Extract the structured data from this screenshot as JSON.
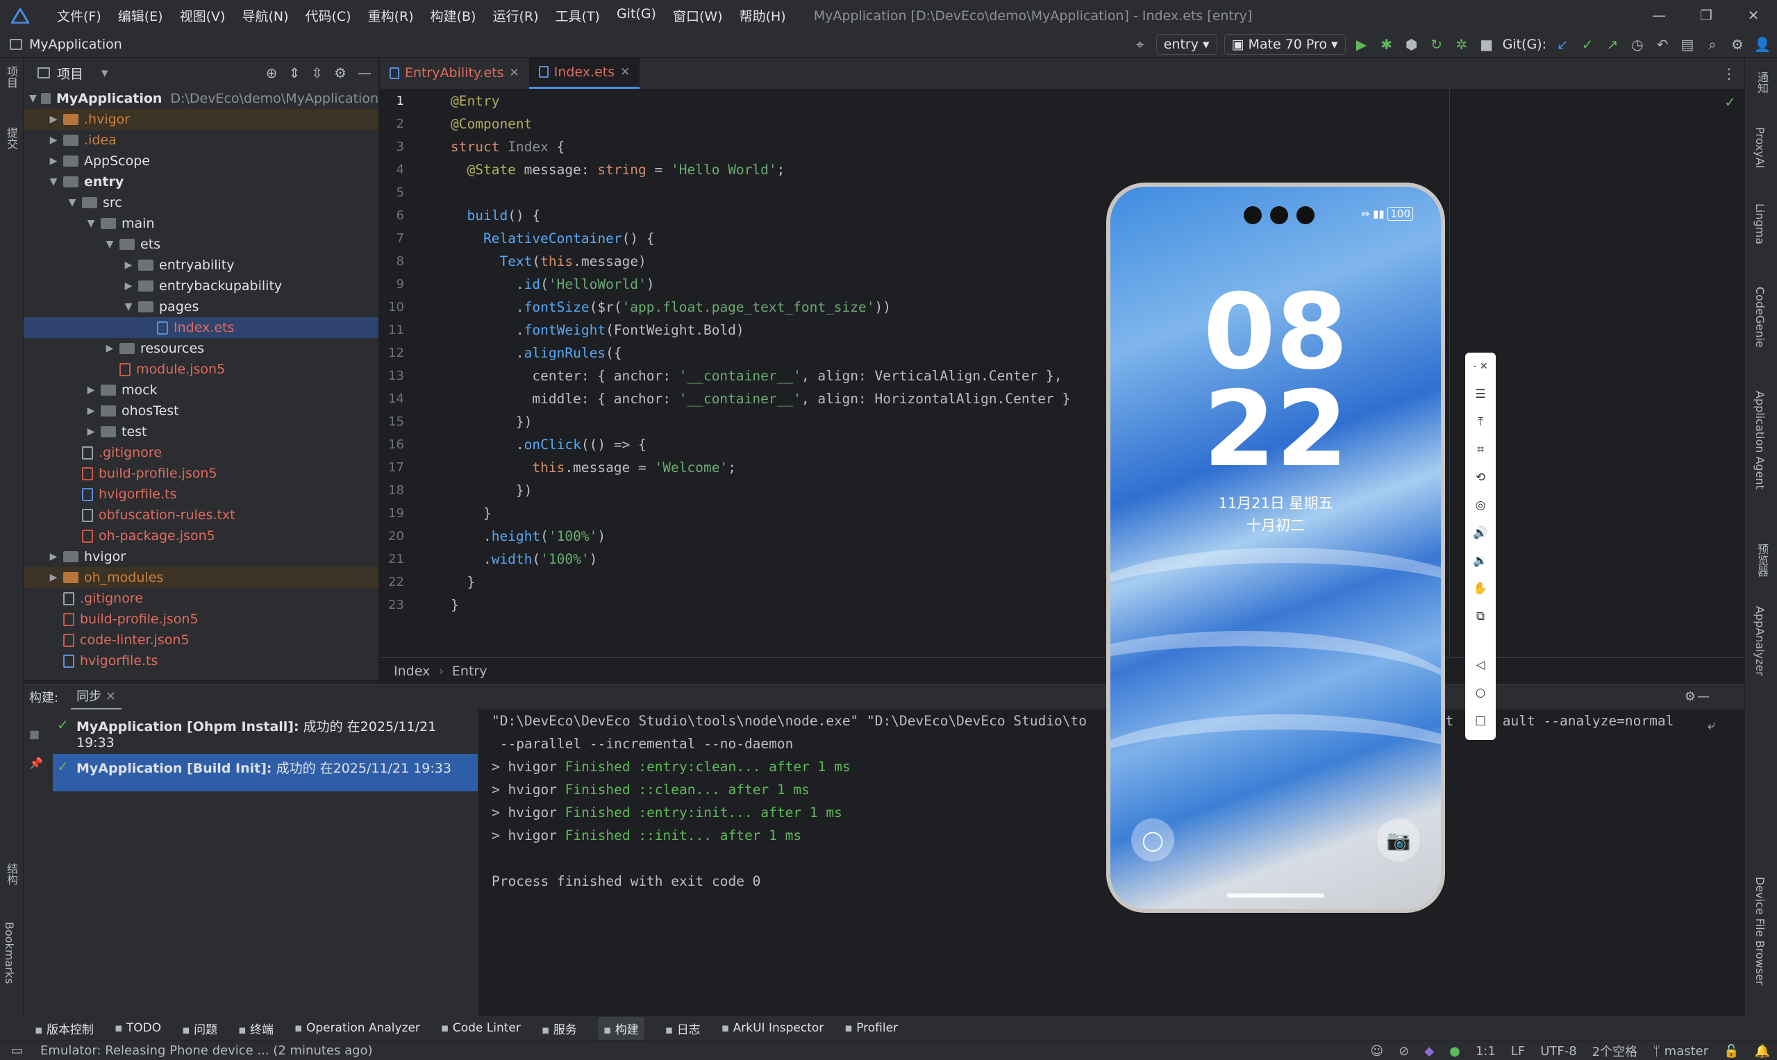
{
  "titlebar": {
    "menus": [
      "文件(F)",
      "编辑(E)",
      "视图(V)",
      "导航(N)",
      "代码(C)",
      "重构(R)",
      "构建(B)",
      "运行(R)",
      "工具(T)",
      "Git(G)",
      "窗口(W)",
      "帮助(H)"
    ],
    "window_title": "MyApplication [D:\\DevEco\\demo\\MyApplication] - Index.ets [entry]"
  },
  "toolbar": {
    "project_name": "MyApplication",
    "run_config": "entry",
    "device": "Mate 70 Pro",
    "git_label": "Git(G):"
  },
  "project_panel": {
    "title": "项目",
    "root": {
      "name": "MyApplication",
      "path": "D:\\DevEco\\demo\\MyApplication"
    },
    "rows": [
      {
        "label": ".hvigor",
        "depth": 1,
        "arrow": "▶",
        "kind": "folder-orange",
        "color": "or",
        "state": "exc"
      },
      {
        "label": ".idea",
        "depth": 1,
        "arrow": "▶",
        "kind": "folder",
        "color": "or",
        "state": ""
      },
      {
        "label": "AppScope",
        "depth": 1,
        "arrow": "▶",
        "kind": "folder",
        "color": "def",
        "state": ""
      },
      {
        "label": "entry",
        "depth": 1,
        "arrow": "▼",
        "kind": "folder",
        "color": "def",
        "state": "",
        "bold": true
      },
      {
        "label": "src",
        "depth": 2,
        "arrow": "▼",
        "kind": "folder",
        "color": "def",
        "state": ""
      },
      {
        "label": "main",
        "depth": 3,
        "arrow": "▼",
        "kind": "folder",
        "color": "def",
        "state": ""
      },
      {
        "label": "ets",
        "depth": 4,
        "arrow": "▼",
        "kind": "folder",
        "color": "def",
        "state": ""
      },
      {
        "label": "entryability",
        "depth": 5,
        "arrow": "▶",
        "kind": "folder",
        "color": "def",
        "state": ""
      },
      {
        "label": "entrybackupability",
        "depth": 5,
        "arrow": "▶",
        "kind": "folder",
        "color": "def",
        "state": ""
      },
      {
        "label": "pages",
        "depth": 5,
        "arrow": "▼",
        "kind": "folder",
        "color": "def",
        "state": ""
      },
      {
        "label": "Index.ets",
        "depth": 6,
        "arrow": "",
        "kind": "file-blue",
        "color": "red",
        "state": "sel"
      },
      {
        "label": "resources",
        "depth": 4,
        "arrow": "▶",
        "kind": "folder",
        "color": "def",
        "state": ""
      },
      {
        "label": "module.json5",
        "depth": 4,
        "arrow": "",
        "kind": "file-red",
        "color": "red",
        "state": ""
      },
      {
        "label": "mock",
        "depth": 3,
        "arrow": "▶",
        "kind": "folder",
        "color": "def",
        "state": ""
      },
      {
        "label": "ohosTest",
        "depth": 3,
        "arrow": "▶",
        "kind": "folder",
        "color": "def",
        "state": ""
      },
      {
        "label": "test",
        "depth": 3,
        "arrow": "▶",
        "kind": "folder",
        "color": "def",
        "state": ""
      },
      {
        "label": ".gitignore",
        "depth": 2,
        "arrow": "",
        "kind": "file",
        "color": "red",
        "state": ""
      },
      {
        "label": "build-profile.json5",
        "depth": 2,
        "arrow": "",
        "kind": "file-red",
        "color": "red",
        "state": ""
      },
      {
        "label": "hvigorfile.ts",
        "depth": 2,
        "arrow": "",
        "kind": "file-blue",
        "color": "red",
        "state": ""
      },
      {
        "label": "obfuscation-rules.txt",
        "depth": 2,
        "arrow": "",
        "kind": "file",
        "color": "red",
        "state": ""
      },
      {
        "label": "oh-package.json5",
        "depth": 2,
        "arrow": "",
        "kind": "file-red",
        "color": "red",
        "state": ""
      },
      {
        "label": "hvigor",
        "depth": 1,
        "arrow": "▶",
        "kind": "folder",
        "color": "def",
        "state": ""
      },
      {
        "label": "oh_modules",
        "depth": 1,
        "arrow": "▶",
        "kind": "folder-orange",
        "color": "or",
        "state": "exc"
      },
      {
        "label": ".gitignore",
        "depth": 1,
        "arrow": "",
        "kind": "file",
        "color": "red",
        "state": ""
      },
      {
        "label": "build-profile.json5",
        "depth": 1,
        "arrow": "",
        "kind": "file-red",
        "color": "red",
        "state": ""
      },
      {
        "label": "code-linter.json5",
        "depth": 1,
        "arrow": "",
        "kind": "file-red",
        "color": "red",
        "state": ""
      },
      {
        "label": "hvigorfile.ts",
        "depth": 1,
        "arrow": "",
        "kind": "file-blue",
        "color": "red",
        "state": ""
      }
    ]
  },
  "editor": {
    "tabs": [
      {
        "label": "EntryAbility.ets",
        "active": false
      },
      {
        "label": "Index.ets",
        "active": true
      }
    ],
    "lines": [
      [
        [
          "an",
          "@Entry"
        ]
      ],
      [
        [
          "an",
          "@Component"
        ]
      ],
      [
        [
          "k",
          "struct "
        ],
        [
          "cls",
          "Index "
        ],
        [
          "w",
          "{"
        ]
      ],
      [
        [
          "w",
          "  "
        ],
        [
          "an",
          "@State "
        ],
        [
          "w",
          "message: "
        ],
        [
          "k",
          "string"
        ],
        [
          "w",
          " = "
        ],
        [
          "s",
          "'Hello World'"
        ],
        [
          "w",
          ";"
        ]
      ],
      [
        [
          "w",
          ""
        ]
      ],
      [
        [
          "w",
          "  "
        ],
        [
          "f",
          "build"
        ],
        [
          "w",
          "() {"
        ]
      ],
      [
        [
          "w",
          "    "
        ],
        [
          "f",
          "RelativeContainer"
        ],
        [
          "w",
          "() {"
        ]
      ],
      [
        [
          "w",
          "      "
        ],
        [
          "f",
          "Text"
        ],
        [
          "w",
          "("
        ],
        [
          "k",
          "this"
        ],
        [
          "w",
          ".message)"
        ]
      ],
      [
        [
          "w",
          "        ."
        ],
        [
          "m",
          "id"
        ],
        [
          "w",
          "("
        ],
        [
          "s",
          "'HelloWorld'"
        ],
        [
          "w",
          ")"
        ]
      ],
      [
        [
          "w",
          "        ."
        ],
        [
          "m",
          "fontSize"
        ],
        [
          "w",
          "($r("
        ],
        [
          "s",
          "'app.float.page_text_font_size'"
        ],
        [
          "w",
          "))"
        ]
      ],
      [
        [
          "w",
          "        ."
        ],
        [
          "m",
          "fontWeight"
        ],
        [
          "w",
          "(FontWeight.Bold)"
        ]
      ],
      [
        [
          "w",
          "        ."
        ],
        [
          "m",
          "alignRules"
        ],
        [
          "w",
          "({"
        ]
      ],
      [
        [
          "w",
          "          center: { anchor: "
        ],
        [
          "s",
          "'__container__'"
        ],
        [
          "w",
          ", align: VerticalAlign.Center },"
        ]
      ],
      [
        [
          "w",
          "          middle: { anchor: "
        ],
        [
          "s",
          "'__container__'"
        ],
        [
          "w",
          ", align: HorizontalAlign.Center }"
        ]
      ],
      [
        [
          "w",
          "        })"
        ]
      ],
      [
        [
          "w",
          "        ."
        ],
        [
          "m",
          "onClick"
        ],
        [
          "w",
          "(() => {"
        ]
      ],
      [
        [
          "w",
          "          "
        ],
        [
          "k",
          "this"
        ],
        [
          "w",
          ".message = "
        ],
        [
          "s",
          "'Welcome'"
        ],
        [
          "w",
          ";"
        ]
      ],
      [
        [
          "w",
          "        })"
        ]
      ],
      [
        [
          "w",
          "    }"
        ]
      ],
      [
        [
          "w",
          "    ."
        ],
        [
          "m",
          "height"
        ],
        [
          "w",
          "("
        ],
        [
          "s",
          "'100%'"
        ],
        [
          "w",
          ")"
        ]
      ],
      [
        [
          "w",
          "    ."
        ],
        [
          "m",
          "width"
        ],
        [
          "w",
          "("
        ],
        [
          "s",
          "'100%'"
        ],
        [
          "w",
          ")"
        ]
      ],
      [
        [
          "w",
          "  }"
        ]
      ],
      [
        [
          "w",
          "}"
        ]
      ]
    ],
    "breadcrumb": [
      "Index",
      "Entry"
    ]
  },
  "build_panel": {
    "label": "构建:",
    "tab": "同步",
    "tasks": [
      {
        "title": "MyApplication [Ohpm Install]:",
        "status": "成功的 在2025/11/21 19:33",
        "selected": false
      },
      {
        "title": "MyApplication [Build Init]:",
        "status": "成功的 在2025/11/21 19:33",
        "selected": true
      }
    ],
    "console": [
      [
        [
          "",
          "\"D:\\DevEco\\DevEco Studio\\tools\\node\\node.exe\" \"D:\\DevEco\\DevEco Studio\\to"
        ],
        [
          "",
          "                                          "
        ],
        [
          "",
          "uct      ault --analyze=normal"
        ]
      ],
      [
        [
          "",
          " --parallel --incremental --no-daemon"
        ]
      ],
      [
        [
          "",
          "> hvigor "
        ],
        [
          "g",
          "Finished :entry:clean... after 1 ms"
        ]
      ],
      [
        [
          "",
          "> hvigor "
        ],
        [
          "g",
          "Finished ::clean... after 1 ms"
        ]
      ],
      [
        [
          "",
          "> hvigor "
        ],
        [
          "g",
          "Finished :entry:init... after 1 ms"
        ]
      ],
      [
        [
          "",
          "> hvigor "
        ],
        [
          "g",
          "Finished ::init... after 1 ms"
        ]
      ],
      [
        [
          "",
          ""
        ]
      ],
      [
        [
          "",
          "Process finished with exit code 0"
        ]
      ]
    ]
  },
  "phone": {
    "battery": "100",
    "hour": "08",
    "minute": "22",
    "date": "11月21日 星期五",
    "lunar": "十月初二"
  },
  "left_strip": [
    "项目",
    "提交",
    "结构",
    "Bookmarks"
  ],
  "right_strip": [
    "通知",
    "ProxyAI",
    "Lingma",
    "CodeGenie",
    "Application Agent",
    "预览器",
    "AppAnalyzer",
    "Device File Browser"
  ],
  "tool_windows": [
    {
      "icon": "git-icon",
      "label": "版本控制",
      "on": false
    },
    {
      "icon": "todo-icon",
      "label": "TODO",
      "on": false
    },
    {
      "icon": "problems-icon",
      "label": "问题",
      "on": false
    },
    {
      "icon": "terminal-icon",
      "label": "终端",
      "on": false
    },
    {
      "icon": "analyzer-icon",
      "label": "Operation Analyzer",
      "on": false
    },
    {
      "icon": "linter-icon",
      "label": "Code Linter",
      "on": false
    },
    {
      "icon": "services-icon",
      "label": "服务",
      "on": false
    },
    {
      "icon": "build-icon",
      "label": "构建",
      "on": true
    },
    {
      "icon": "log-icon",
      "label": "日志",
      "on": false
    },
    {
      "icon": "inspector-icon",
      "label": "ArkUI Inspector",
      "on": false
    },
    {
      "icon": "profiler-icon",
      "label": "Profiler",
      "on": false
    }
  ],
  "status_bar": {
    "message": "Emulator: Releasing Phone device ... (2 minutes ago)",
    "position": "1:1",
    "line_sep": "LF",
    "encoding": "UTF-8",
    "indent": "2个空格",
    "branch": "master"
  },
  "colors": {
    "accent": "#4a8be0",
    "selection": "#2f5ea8",
    "success": "#5fb85a"
  }
}
